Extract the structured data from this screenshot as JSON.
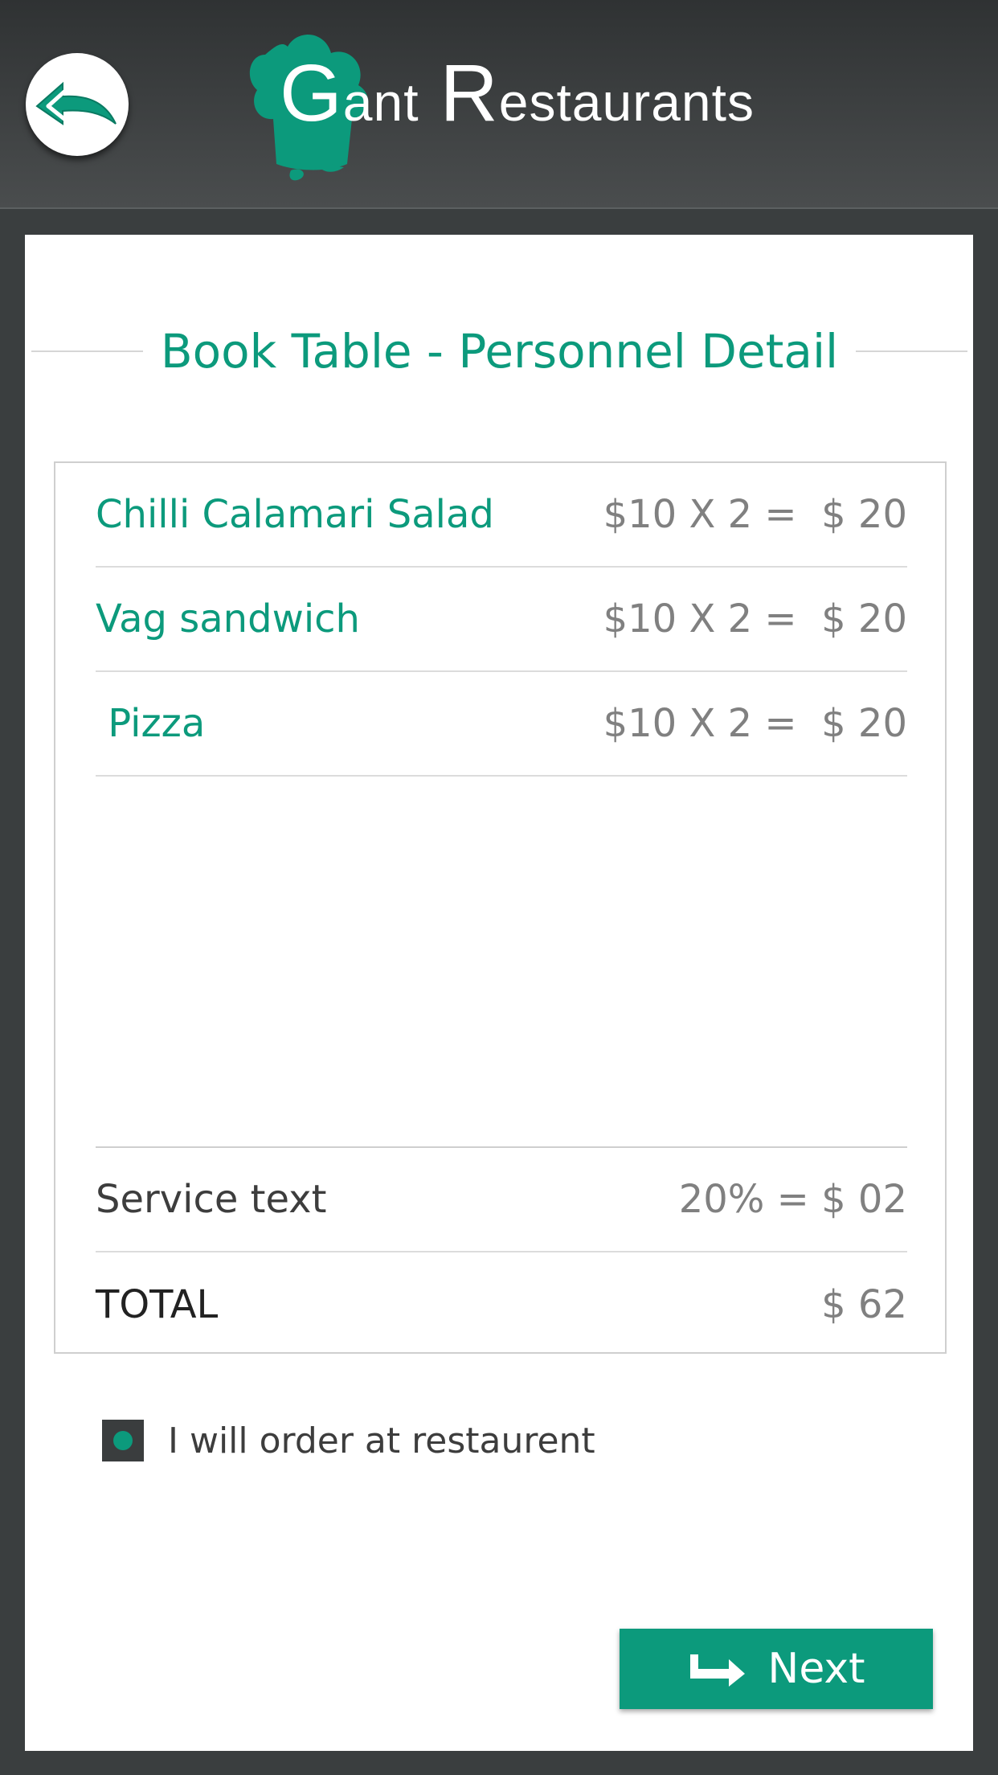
{
  "header": {
    "back_icon": "back-arrow-icon",
    "logo": {
      "first_letter": "G",
      "first_rest": "ant",
      "second_letter": "R",
      "second_rest": "estaurants",
      "hat_icon": "chef-hat-icon"
    }
  },
  "page": {
    "title": "Book Table - Personnel Detail"
  },
  "order": {
    "items": [
      {
        "name": "Chilli Calamari Salad",
        "price": "$10 X 2 =  $ 20"
      },
      {
        "name": "Vag sandwich",
        "price": "$10 X 2 =  $ 20"
      },
      {
        "name": " Pizza",
        "price": "$10 X 2 =  $ 20"
      }
    ],
    "service": {
      "label": "Service text",
      "value": "20% = $ 02"
    },
    "total": {
      "label": "TOTAL",
      "value": "$ 62"
    }
  },
  "checkbox": {
    "label": "I will order at restaurent",
    "checked": true
  },
  "next_button": {
    "label": "Next",
    "icon": "arrow-right-turn-icon"
  },
  "colors": {
    "accent": "#0c9a7c",
    "background": "#3a3e3f",
    "card": "#ffffff"
  }
}
